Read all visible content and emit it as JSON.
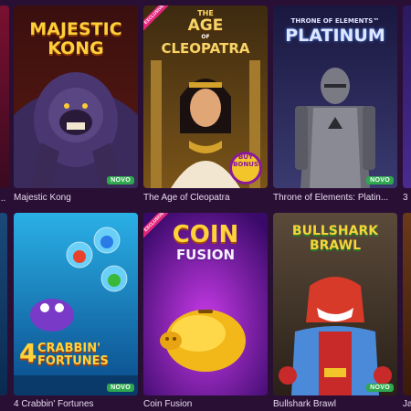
{
  "colors": {
    "background": "#2a0f35",
    "new_badge": "#2fa84f",
    "exclusive_ribbon": "#e3267b"
  },
  "row1": {
    "left_partial_title": "...",
    "majestic_kong": {
      "title": "Majestic Kong",
      "logo_line1": "MAJESTIC",
      "logo_line2": "KONG",
      "badge": "NOVO"
    },
    "cleopatra": {
      "title": "The Age of Cleopatra",
      "ribbon": "EXCLUSIVE",
      "logo_top": "THE",
      "logo_mid": "AGE",
      "logo_of": "OF",
      "logo_bottom": "CLEOPATRA",
      "buy_bonus_1": "BUY",
      "buy_bonus_2": "BONUS"
    },
    "throne": {
      "title": "Throne of Elements: Platin...",
      "logo_top": "THRONE OF ELEMENTS™",
      "logo_main": "PLATINUM",
      "badge": "NOVO"
    },
    "right_partial_title": "3"
  },
  "row2": {
    "crabbin": {
      "title": "4 Crabbin' Fortunes",
      "logo_number": "4",
      "logo_line1": "CRABBIN'",
      "logo_line2": "FORTUNES",
      "badge": "NOVO"
    },
    "coin_fusion": {
      "title": "Coin Fusion",
      "ribbon": "EXCLUSIVE",
      "logo_line1": "COIN",
      "logo_line2": "FUSION"
    },
    "bullshark": {
      "title": "Bullshark Brawl",
      "logo_line1": "BULLSHARK",
      "logo_line2": "BRAWL",
      "badge": "NOVO"
    },
    "right_partial_title": "Ja"
  }
}
